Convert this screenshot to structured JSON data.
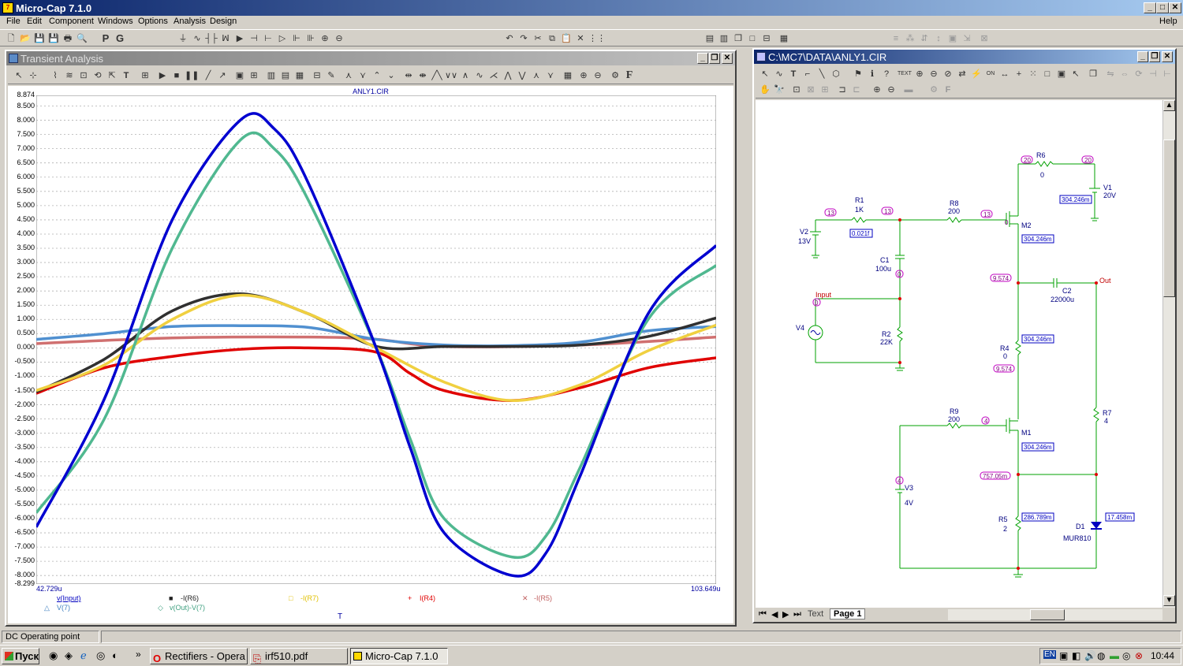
{
  "app": {
    "title": "Micro-Cap 7.1.0",
    "menus": [
      "File",
      "Edit",
      "Component",
      "Windows",
      "Options",
      "Analysis",
      "Design"
    ],
    "help": "Help"
  },
  "toolbar": {
    "p_label": "P",
    "g_label": "G"
  },
  "transient": {
    "window_title": "Transient Analysis",
    "chart_title": "ANLY1.CIR",
    "x_min_label": "42.729u",
    "x_max_label": "103.649u",
    "x_axis_label": "T",
    "y_top_label": "8.874",
    "y_bottom_label": "-8.299",
    "y_ticks": [
      "8.500",
      "8.000",
      "7.500",
      "7.000",
      "6.500",
      "6.000",
      "5.500",
      "5.000",
      "4.500",
      "4.000",
      "3.500",
      "3.000",
      "2.500",
      "2.000",
      "1.500",
      "1.000",
      "0.500",
      "0.000",
      "-0.500",
      "-1.000",
      "-1.500",
      "-2.000",
      "-2.500",
      "-3.000",
      "-3.500",
      "-4.000",
      "-4.500",
      "-5.000",
      "-5.500",
      "-6.000",
      "-6.500",
      "-7.000",
      "-7.500",
      "-8.000"
    ],
    "legend": [
      {
        "marker": "",
        "label": "v(Input)",
        "color": "#0000c0"
      },
      {
        "marker": "■",
        "label": "-I(R6)",
        "color": "#202020"
      },
      {
        "marker": "□",
        "label": "-I(R7)",
        "color": "#e0c000"
      },
      {
        "marker": "+",
        "label": "I(R4)",
        "color": "#e00000"
      },
      {
        "marker": "✕",
        "label": "-I(R5)",
        "color": "#c06060"
      },
      {
        "marker": "△",
        "label": "V(7)",
        "color": "#4080c0"
      },
      {
        "marker": "◇",
        "label": "v(Out)-V(7)",
        "color": "#40a080"
      }
    ]
  },
  "chart_data": {
    "type": "line",
    "title": "ANLY1.CIR",
    "xlabel": "T",
    "xlim": [
      "42.729u",
      "103.649u"
    ],
    "ylim": [
      -8.299,
      8.874
    ],
    "grid": true,
    "legend_position": "bottom",
    "series": [
      {
        "name": "v(Input)",
        "color": "#0000d0",
        "x": [
          0,
          0.1,
          0.2,
          0.3,
          0.35,
          0.4,
          0.5,
          0.55,
          0.6,
          0.7,
          0.75,
          0.8,
          0.9,
          1.0
        ],
        "values": [
          -6.3,
          -1.8,
          4.5,
          8.0,
          7.7,
          5.8,
          0.0,
          -3.5,
          -6.5,
          -8.0,
          -7.2,
          -4.5,
          1.2,
          3.6
        ]
      },
      {
        "name": "-I(R6)",
        "color": "#303030",
        "x": [
          0,
          0.1,
          0.2,
          0.3,
          0.4,
          0.5,
          0.6,
          0.7,
          0.8,
          0.9,
          1.0
        ],
        "values": [
          -1.55,
          -0.4,
          1.3,
          1.9,
          1.2,
          0.05,
          0.05,
          0.05,
          0.1,
          0.4,
          1.05
        ]
      },
      {
        "name": "-I(R7)",
        "color": "#f0d040",
        "x": [
          0,
          0.1,
          0.2,
          0.3,
          0.4,
          0.5,
          0.6,
          0.7,
          0.8,
          0.9,
          1.0
        ],
        "values": [
          -1.5,
          -0.6,
          1.0,
          1.85,
          1.2,
          0.0,
          -1.2,
          -1.85,
          -1.3,
          -0.1,
          0.8
        ]
      },
      {
        "name": "I(R4)",
        "color": "#e00000",
        "x": [
          0,
          0.1,
          0.2,
          0.3,
          0.4,
          0.5,
          0.55,
          0.6,
          0.7,
          0.8,
          0.9,
          1.0
        ],
        "values": [
          -1.6,
          -0.7,
          -0.3,
          -0.05,
          0.0,
          -0.15,
          -0.9,
          -1.5,
          -1.85,
          -1.4,
          -0.7,
          -0.35
        ]
      },
      {
        "name": "-I(R5)",
        "color": "#d07070",
        "x": [
          0,
          0.2,
          0.4,
          0.5,
          0.6,
          0.8,
          1.0
        ],
        "values": [
          0.15,
          0.35,
          0.38,
          0.3,
          0.05,
          0.1,
          0.38
        ]
      },
      {
        "name": "V(7)",
        "color": "#5090d0",
        "x": [
          0,
          0.1,
          0.2,
          0.3,
          0.4,
          0.5,
          0.6,
          0.7,
          0.8,
          0.9,
          1.0
        ],
        "values": [
          0.3,
          0.5,
          0.75,
          0.78,
          0.72,
          0.3,
          0.1,
          0.08,
          0.2,
          0.6,
          0.75
        ]
      },
      {
        "name": "v(Out)-V(7)",
        "color": "#50b890",
        "x": [
          0,
          0.1,
          0.2,
          0.3,
          0.35,
          0.4,
          0.5,
          0.55,
          0.6,
          0.7,
          0.75,
          0.8,
          0.9,
          1.0
        ],
        "values": [
          -5.8,
          -2.5,
          3.5,
          7.3,
          7.0,
          5.2,
          0.0,
          -3.2,
          -6.0,
          -7.35,
          -6.6,
          -4.2,
          1.0,
          2.9
        ]
      }
    ]
  },
  "schematic": {
    "window_title": "C:\\MC7\\DATA\\ANLY1.CIR",
    "labels": {
      "r1": "R1",
      "r1v": "1K",
      "r1cur": "0.021f",
      "v2": "V2",
      "v2v": "13V",
      "r8": "R8",
      "r8v": "200",
      "r6": "R6",
      "r6v": "0",
      "v1": "V1",
      "v1v": "20V",
      "v1cur": "304.246m",
      "m2": "M2",
      "m2cur": "304.246m",
      "c1": "C1",
      "c1v": "100u",
      "c2": "C2",
      "c2v": "22000u",
      "input": "Input",
      "out": "Out",
      "v4": "V4",
      "r2": "R2",
      "r2v": "22K",
      "r4": "R4",
      "r4v": "0",
      "r4cur": "304.246m",
      "r9": "R9",
      "r9v": "200",
      "m1": "M1",
      "m1cur": "304.246m",
      "r7": "R7",
      "r7v": "4",
      "v3": "V3",
      "v3v": "4V",
      "r5": "R5",
      "r5v": "2",
      "r5cur": "286.789m",
      "d1": "D1",
      "d1v": "MUR810",
      "d1cur": "17.458m",
      "n757": "757.05m",
      "n13a": "13",
      "n13b": "13",
      "n13c": "13",
      "n20a": "20",
      "n20b": "20",
      "n0a": "0",
      "n0b": "0",
      "n0c": "0",
      "n9574a": "9.574",
      "n9574b": "9.574",
      "n4a": "4",
      "n4b": "4"
    },
    "tabs": {
      "text": "Text",
      "page": "Page 1"
    }
  },
  "status": {
    "left": "DC Operating point"
  },
  "taskbar": {
    "start": "Пуск",
    "tasks": [
      "Rectifiers - Opera",
      "irf510.pdf",
      "Micro-Cap 7.1.0"
    ],
    "clock": "10:44",
    "lang": "EN"
  }
}
